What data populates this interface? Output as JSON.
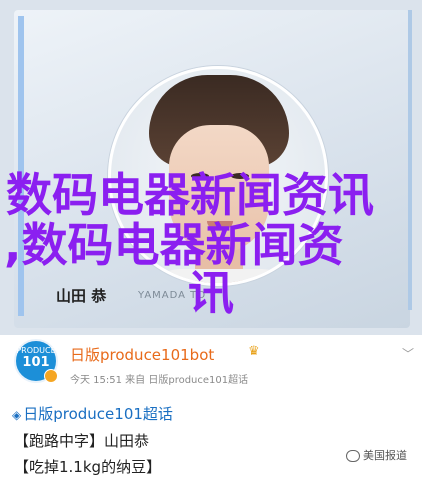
{
  "profile_card": {
    "name_label": "山田 恭",
    "watermark_brand": "YAMADA TO",
    "overlay_line1": "数码电器新闻资讯",
    "overlay_line2": ",数码电器新闻资",
    "overlay_line3": "讯"
  },
  "post": {
    "avatar_top": "PRODUCE",
    "avatar_bottom": "101",
    "user_name": "日版produce101bot",
    "crown_icon": "crown-icon",
    "meta": "今天 15:51  来自 日版produce101超话",
    "super_topic": "日版produce101超话",
    "line1": "【跑路中字】山田恭",
    "line2": "【吃掉1.1kg的纳豆】",
    "source_badge": "美国报道"
  },
  "colors": {
    "overlay": "#8b1ff0",
    "username": "#e86a1a",
    "topic": "#1a6fc2"
  }
}
